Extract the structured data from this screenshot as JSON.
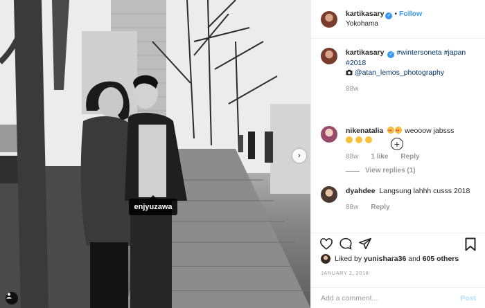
{
  "photo": {
    "user_tag": "enjyuzawa",
    "next_icon": "chevron-right-icon",
    "tag_icon": "person-tag-icon"
  },
  "header": {
    "username": "kartikasary",
    "verified_icon": "verified-badge-icon",
    "separator": "•",
    "follow_label": "Follow",
    "location": "Yokohama"
  },
  "caption": {
    "username": "kartikasary",
    "hashtags": "#wintersoneta #japan #2018",
    "camera_icon": "camera-icon",
    "credit": "@atan_lemos_photography",
    "age": "88w"
  },
  "load_more_icon": "plus-circle-icon",
  "comments": [
    {
      "username": "nikenatalia",
      "text": "weooow jabsss",
      "emojis_leading": [
        "heart-eyes-emoji",
        "heart-eyes-emoji"
      ],
      "emojis_trailing": [
        "grin-emoji",
        "smile-emoji",
        "smile-emoji"
      ],
      "age": "88w",
      "likes": "1 like",
      "reply_label": "Reply",
      "view_replies": "View replies (1)"
    },
    {
      "username": "dyahdee",
      "text": "Langsung lahhh cusss 2018",
      "age": "88w",
      "reply_label": "Reply"
    }
  ],
  "actions": {
    "like_icon": "heart-icon",
    "comment_icon": "comment-icon",
    "share_icon": "share-icon",
    "save_icon": "bookmark-icon"
  },
  "likes": {
    "prefix": "Liked by",
    "user": "yunishara36",
    "conjunction": "and",
    "others": "605 others"
  },
  "date": "JANUARY 2, 2018",
  "add_comment": {
    "placeholder": "Add a comment...",
    "post_label": "Post"
  },
  "colors": {
    "accent": "#3897f0",
    "hashtag": "#003569",
    "muted": "#999999",
    "post_disabled": "#b2dffc"
  }
}
